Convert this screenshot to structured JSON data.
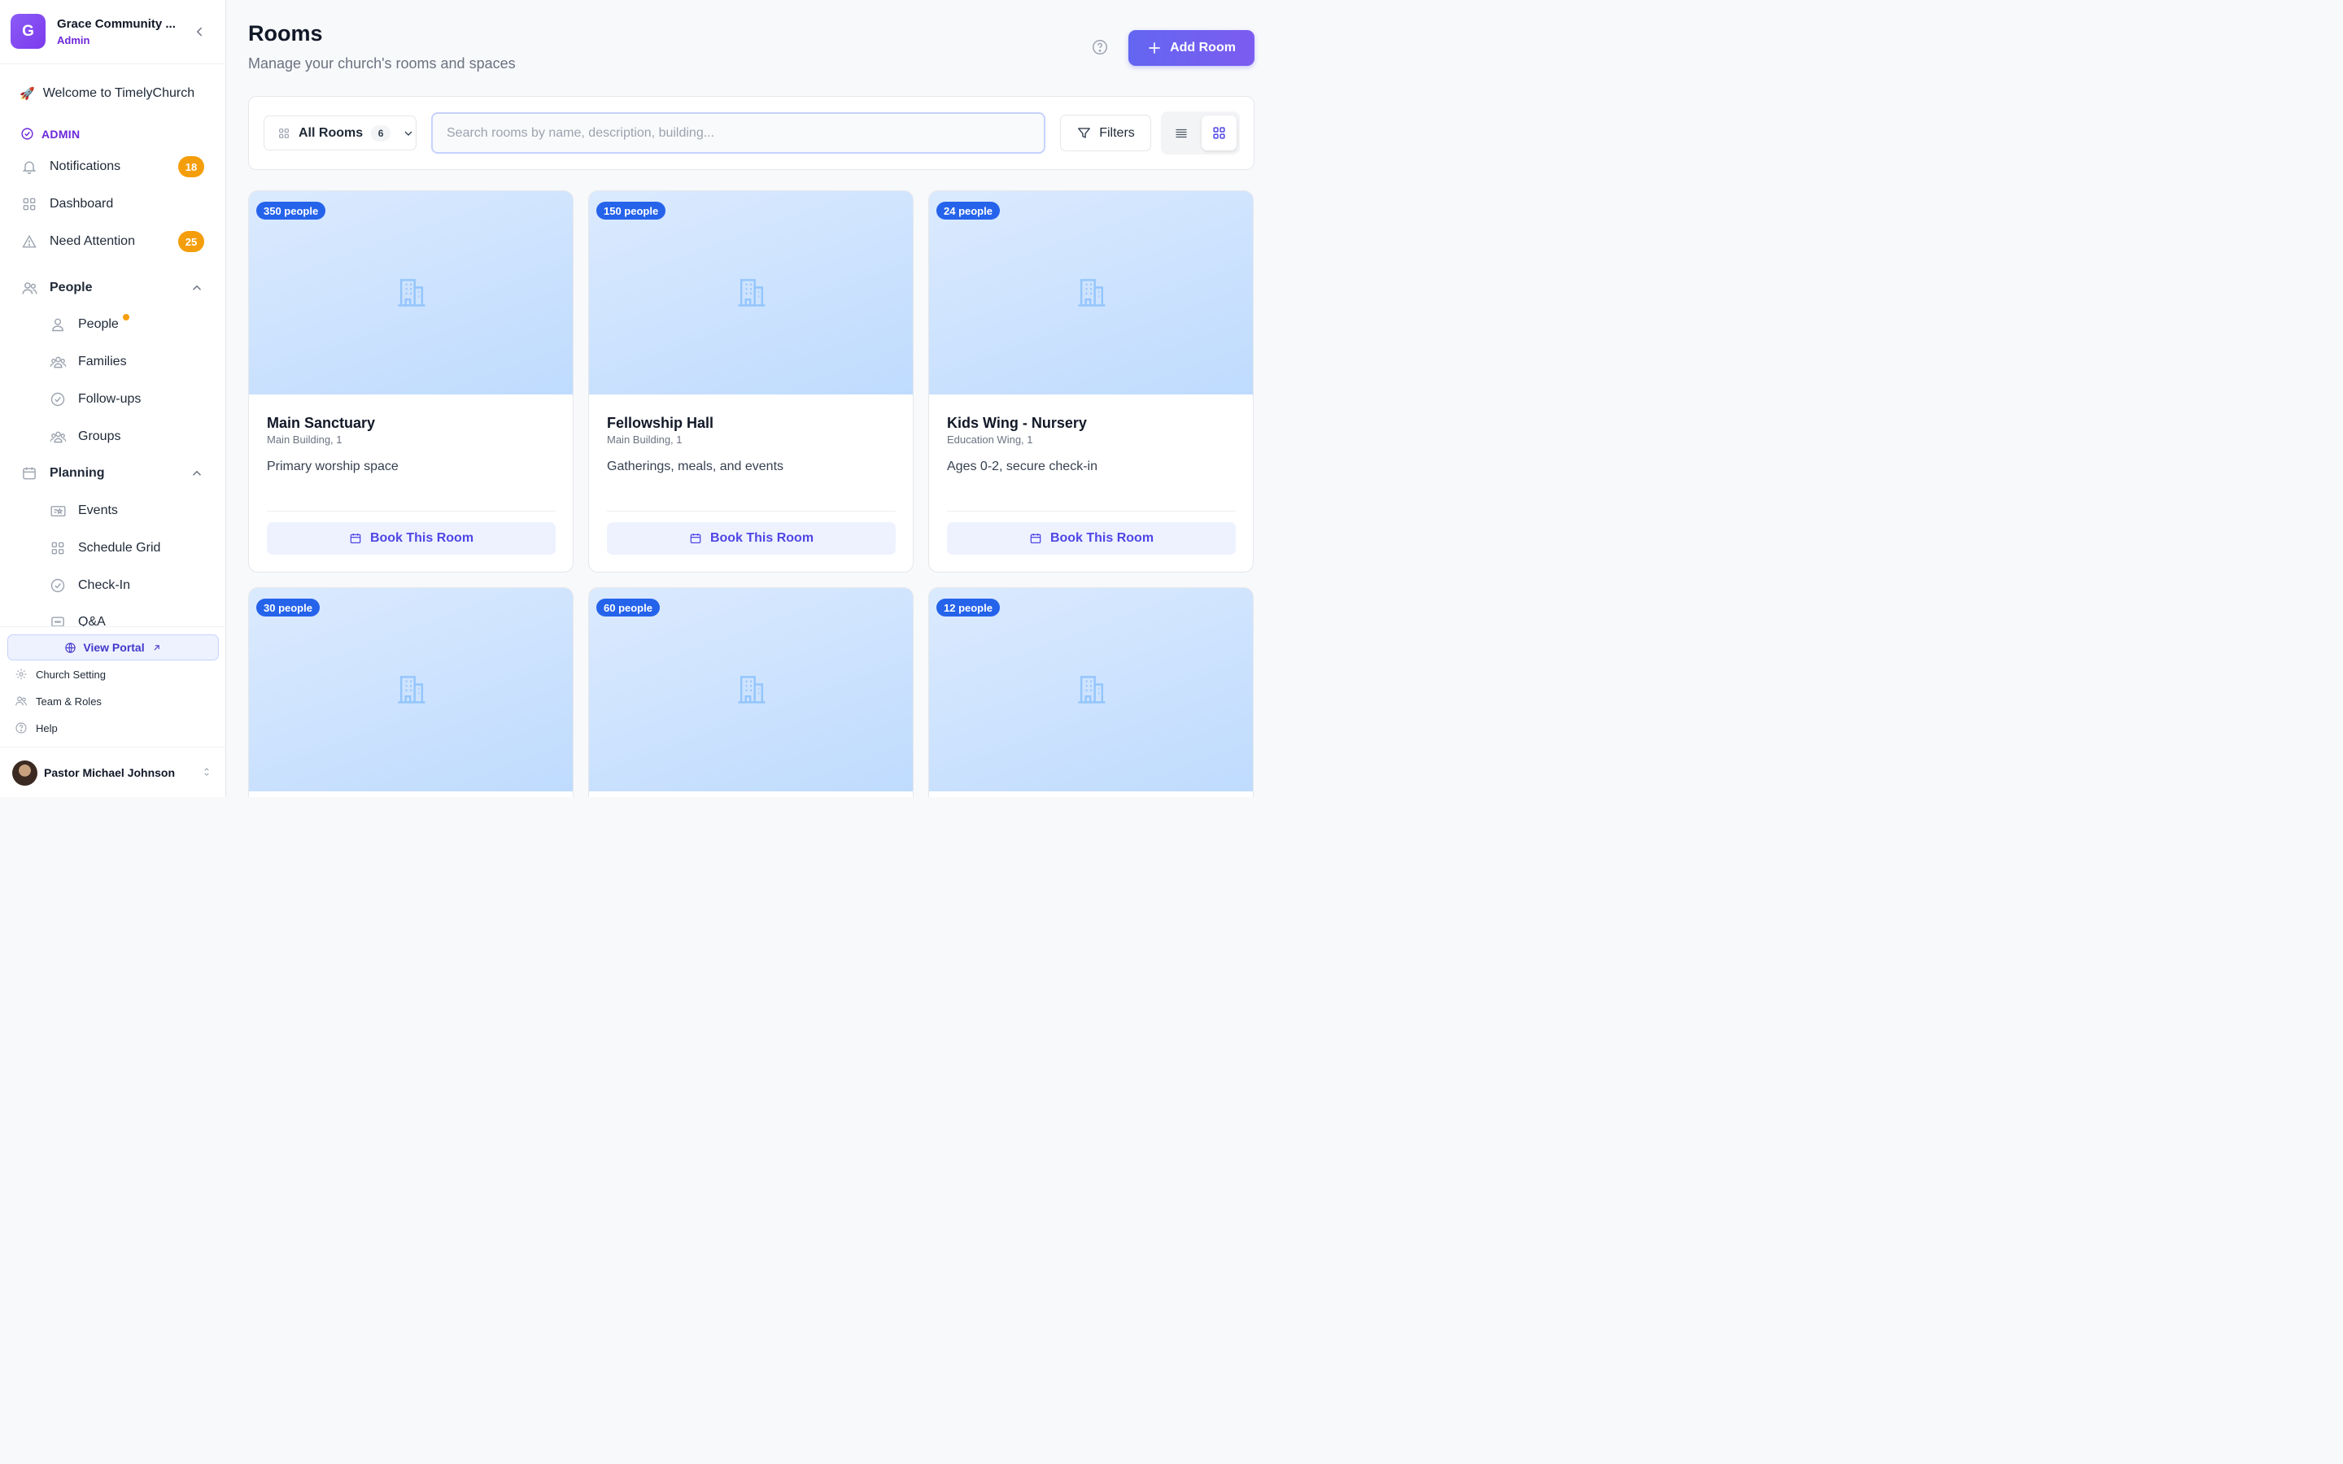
{
  "org": {
    "initial": "G",
    "name": "Grace Community ...",
    "role": "Admin"
  },
  "sidebar": {
    "welcome": "Welcome to TimelyChurch",
    "section_label": "ADMIN",
    "items": [
      {
        "label": "Notifications",
        "badge": "18"
      },
      {
        "label": "Dashboard"
      },
      {
        "label": "Need Attention",
        "badge": "25"
      },
      {
        "label": "People"
      },
      {
        "label": "People"
      },
      {
        "label": "Families"
      },
      {
        "label": "Follow-ups"
      },
      {
        "label": "Groups"
      },
      {
        "label": "Planning"
      },
      {
        "label": "Events"
      },
      {
        "label": "Schedule Grid"
      },
      {
        "label": "Check-In"
      },
      {
        "label": "Q&A"
      }
    ],
    "portal": "View Portal",
    "links": [
      "Church Setting",
      "Team & Roles",
      "Help"
    ],
    "user": "Pastor Michael Johnson"
  },
  "header": {
    "title": "Rooms",
    "subtitle": "Manage your church's rooms and spaces",
    "add_button": "Add Room"
  },
  "toolbar": {
    "filter_label": "All Rooms",
    "filter_count": "6",
    "search_placeholder": "Search rooms by name, description, building...",
    "search_value": "",
    "filters_label": "Filters"
  },
  "rooms": [
    {
      "capacity": "350 people",
      "name": "Main Sanctuary",
      "location": "Main Building, 1",
      "description": "Primary worship space",
      "action": "Book This Room"
    },
    {
      "capacity": "150 people",
      "name": "Fellowship Hall",
      "location": "Main Building, 1",
      "description": "Gatherings, meals, and events",
      "action": "Book This Room"
    },
    {
      "capacity": "24 people",
      "name": "Kids Wing - Nursery",
      "location": "Education Wing, 1",
      "description": "Ages 0-2, secure check-in",
      "action": "Book This Room"
    },
    {
      "capacity": "30 people"
    },
    {
      "capacity": "60 people"
    },
    {
      "capacity": "12 people"
    }
  ],
  "colors": {
    "accent": "#6366f1",
    "badge_orange": "#f59e0b",
    "capacity_blue": "#2563eb"
  }
}
